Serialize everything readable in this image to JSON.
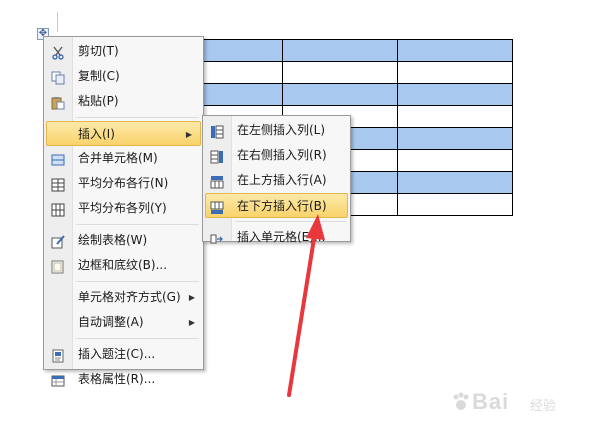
{
  "table": {
    "rows": 8,
    "cols": 4,
    "highlighted_rows": [
      0,
      2,
      4,
      6
    ]
  },
  "context_menu": {
    "items": [
      {
        "label": "剪切(T)",
        "icon": "scissors-icon"
      },
      {
        "label": "复制(C)",
        "icon": "copy-icon"
      },
      {
        "label": "粘贴(P)",
        "icon": "paste-icon"
      },
      {
        "label": "插入(I)",
        "icon": "",
        "has_submenu": true,
        "active": true
      },
      {
        "label": "合并单元格(M)",
        "icon": "merge-cells-icon"
      },
      {
        "label": "平均分布各行(N)",
        "icon": "distribute-rows-icon"
      },
      {
        "label": "平均分布各列(Y)",
        "icon": "distribute-columns-icon"
      },
      {
        "label": "绘制表格(W)",
        "icon": "draw-table-icon"
      },
      {
        "label": "边框和底纹(B)...",
        "icon": "borders-icon"
      },
      {
        "label": "单元格对齐方式(G)",
        "icon": "",
        "has_submenu": true
      },
      {
        "label": "自动调整(A)",
        "icon": "",
        "has_submenu": true
      },
      {
        "label": "插入题注(C)...",
        "icon": "caption-icon"
      },
      {
        "label": "表格属性(R)...",
        "icon": "table-properties-icon"
      }
    ]
  },
  "insert_submenu": {
    "items": [
      {
        "label": "在左侧插入列(L)",
        "icon": "insert-column-left-icon"
      },
      {
        "label": "在右侧插入列(R)",
        "icon": "insert-column-right-icon"
      },
      {
        "label": "在上方插入行(A)",
        "icon": "insert-row-above-icon"
      },
      {
        "label": "在下方插入行(B)",
        "icon": "insert-row-below-icon",
        "active": true
      },
      {
        "label": "插入单元格(E)...",
        "icon": "insert-cells-icon"
      }
    ]
  },
  "watermark": {
    "text": "Bai",
    "suffix": "经验"
  },
  "colors": {
    "table_highlight": "#a9c8ef",
    "menu_active": "#f9d36b",
    "annotation_arrow": "#e8383d"
  }
}
